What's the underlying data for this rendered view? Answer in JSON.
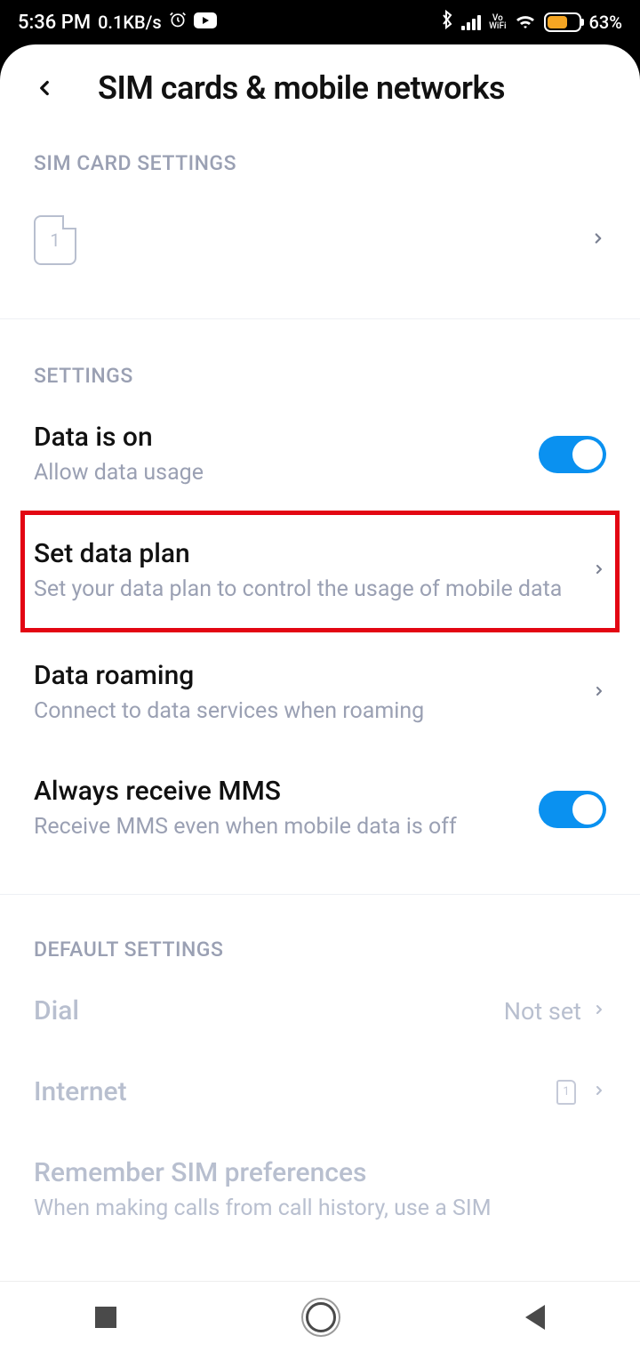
{
  "status": {
    "time": "5:36 PM",
    "net_speed": "0.1KB/s",
    "vowifi_top": "Vo",
    "vowifi_bot": "WiFi",
    "battery_pct": "63%"
  },
  "header": {
    "title": "SIM cards & mobile networks"
  },
  "sections": {
    "sim_card_settings": "SIM CARD SETTINGS",
    "settings": "SETTINGS",
    "default_settings": "DEFAULT SETTINGS"
  },
  "sim": {
    "slot_label": "1"
  },
  "rows": {
    "data": {
      "title": "Data is on",
      "sub": "Allow data usage"
    },
    "plan": {
      "title": "Set data plan",
      "sub": "Set your data plan to control the usage of mobile data"
    },
    "roaming": {
      "title": "Data roaming",
      "sub": "Connect to data services when roaming"
    },
    "mms": {
      "title": "Always receive MMS",
      "sub": "Receive MMS even when mobile data is off"
    },
    "dial": {
      "title": "Dial",
      "value": "Not set"
    },
    "internet": {
      "title": "Internet",
      "sim": "1"
    },
    "remember": {
      "title": "Remember SIM preferences",
      "sub": "When making calls from call history, use a SIM"
    }
  }
}
